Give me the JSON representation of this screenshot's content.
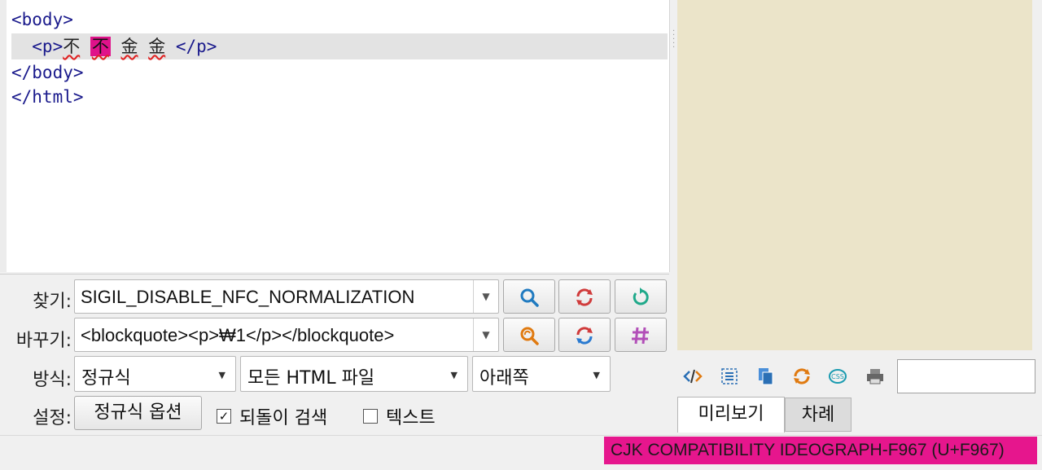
{
  "editor": {
    "lines": [
      "<body>",
      "  <p>",
      "</body>",
      "</html>"
    ],
    "p_close": "</p>",
    "cjk_chars": [
      "不",
      "不",
      "金",
      "金"
    ]
  },
  "find_panel": {
    "find_label": "찾기:",
    "find_value": "SIGIL_DISABLE_NFC_NORMALIZATION",
    "replace_label": "바꾸기:",
    "replace_value": "<blockquote><p>₩1</p></blockquote>",
    "mode_label": "방식:",
    "mode_value": "정규식",
    "scope_value": "모든 HTML 파일",
    "direction_value": "아래쪽",
    "settings_label": "설정:",
    "regex_options_label": "정규식 옵션",
    "wrap_label": "되돌이 검색",
    "wrap_checked": true,
    "text_label": "텍스트",
    "text_checked": false,
    "icons": [
      "search-icon",
      "replace-icon",
      "refresh-icon",
      "find-replace-icon",
      "replace-all-icon",
      "count-icon"
    ]
  },
  "status": {
    "text": "CJK COMPATIBILITY IDEOGRAPH-F967 (U+F967)",
    "highlight_color": "#e6168d"
  },
  "preview": {
    "background": "#ebe4c9",
    "tabs": [
      "미리보기",
      "차례"
    ],
    "toolbar_icons": [
      "code-icon",
      "select-icon",
      "copy-icon",
      "reload-icon",
      "css-icon",
      "print-icon"
    ],
    "input_value": ""
  }
}
